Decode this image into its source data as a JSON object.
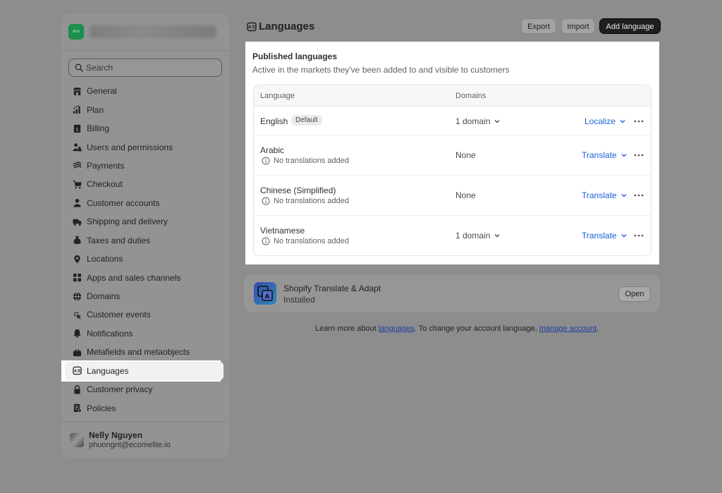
{
  "sidebar": {
    "store_logo_text": "eco",
    "search_placeholder": "Search",
    "items": [
      {
        "label": "General",
        "icon": "store-icon"
      },
      {
        "label": "Plan",
        "icon": "plan-icon"
      },
      {
        "label": "Billing",
        "icon": "billing-icon"
      },
      {
        "label": "Users and permissions",
        "icon": "users-icon"
      },
      {
        "label": "Payments",
        "icon": "payments-icon"
      },
      {
        "label": "Checkout",
        "icon": "cart-icon"
      },
      {
        "label": "Customer accounts",
        "icon": "person-icon"
      },
      {
        "label": "Shipping and delivery",
        "icon": "truck-icon"
      },
      {
        "label": "Taxes and duties",
        "icon": "taxes-icon"
      },
      {
        "label": "Locations",
        "icon": "location-icon"
      },
      {
        "label": "Apps and sales channels",
        "icon": "apps-icon"
      },
      {
        "label": "Domains",
        "icon": "globe-icon"
      },
      {
        "label": "Customer events",
        "icon": "events-icon"
      },
      {
        "label": "Notifications",
        "icon": "bell-icon"
      },
      {
        "label": "Metafields and metaobjects",
        "icon": "metafields-icon"
      },
      {
        "label": "Languages",
        "icon": "languages-icon",
        "active": true
      },
      {
        "label": "Customer privacy",
        "icon": "lock-icon"
      },
      {
        "label": "Policies",
        "icon": "policies-icon"
      }
    ],
    "user": {
      "name": "Nelly Nguyen",
      "email": "phuongnt@ecomelite.io"
    }
  },
  "header": {
    "title": "Languages",
    "export_label": "Export",
    "import_label": "Import",
    "add_label": "Add language"
  },
  "published": {
    "title": "Published languages",
    "subtitle": "Active in the markets they've been added to and visible to customers",
    "col_language": "Language",
    "col_domains": "Domains",
    "rows": [
      {
        "name": "English",
        "badge": "Default",
        "note": "",
        "domains": "1 domain",
        "action": "Localize"
      },
      {
        "name": "Arabic",
        "badge": "",
        "note": "No translations added",
        "domains": "None",
        "action": "Translate"
      },
      {
        "name": "Chinese (Simplified)",
        "badge": "",
        "note": "No translations added",
        "domains": "None",
        "action": "Translate"
      },
      {
        "name": "Vietnamese",
        "badge": "",
        "note": "No translations added",
        "domains": "1 domain",
        "action": "Translate"
      }
    ]
  },
  "app": {
    "name": "Shopify Translate & Adapt",
    "status": "Installed",
    "open_label": "Open"
  },
  "footer": {
    "prefix": "Learn more about ",
    "link1": "languages",
    "middle": ". To change your account language, ",
    "link2": "manage account",
    "suffix": "."
  },
  "colors": {
    "link": "#1a62d6",
    "primary_button": "#1f1f1f"
  }
}
